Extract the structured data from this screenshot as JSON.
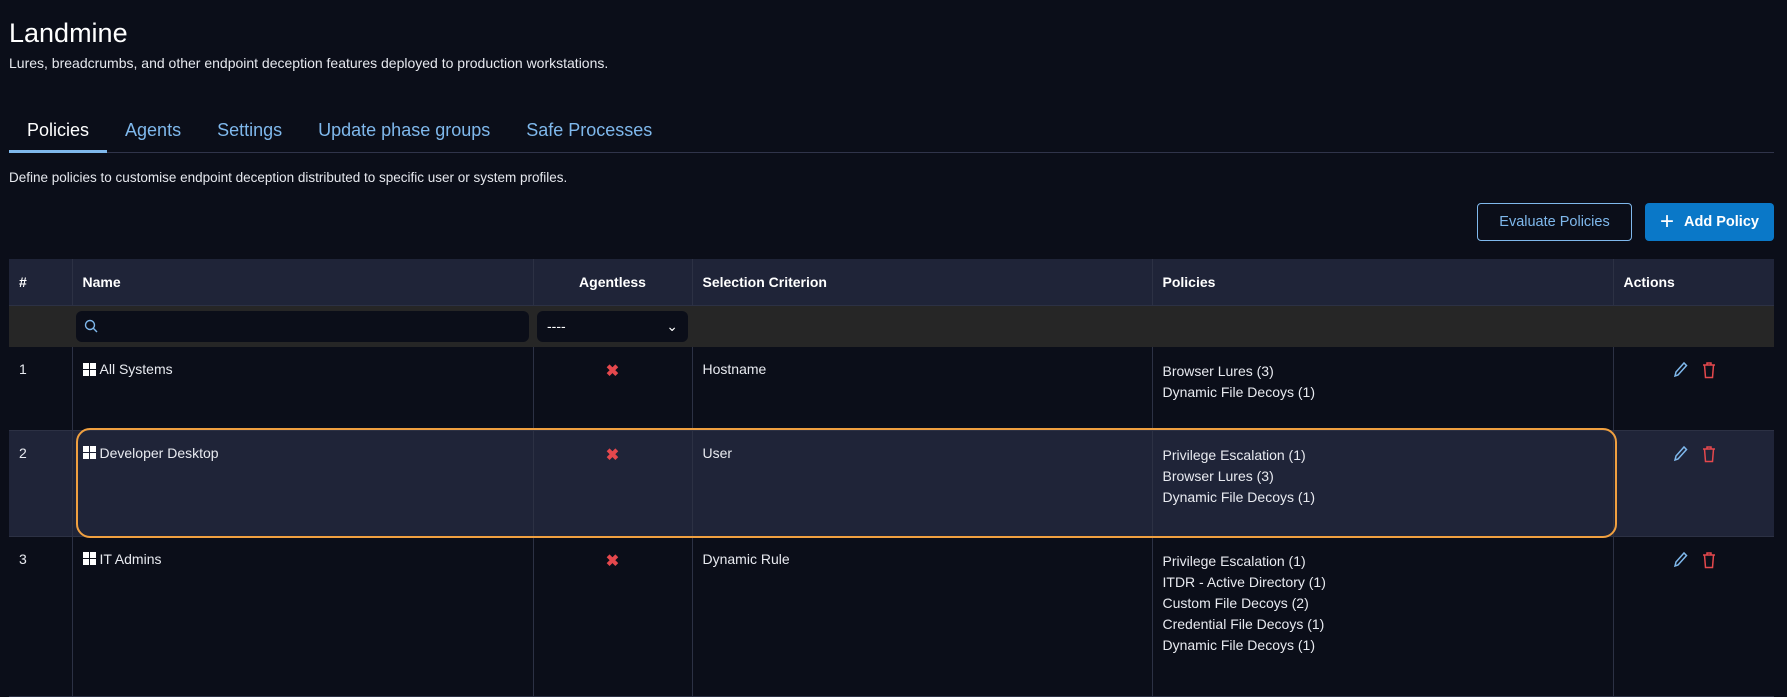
{
  "header": {
    "title": "Landmine",
    "subtitle": "Lures, breadcrumbs, and other endpoint deception features deployed to production workstations."
  },
  "tabs": [
    {
      "label": "Policies",
      "active": true
    },
    {
      "label": "Agents"
    },
    {
      "label": "Settings"
    },
    {
      "label": "Update phase groups"
    },
    {
      "label": "Safe Processes"
    }
  ],
  "description": "Define policies to customise endpoint deception distributed to specific user or system profiles.",
  "toolbar": {
    "evaluate_label": "Evaluate Policies",
    "add_label": "Add Policy"
  },
  "table": {
    "columns": [
      "#",
      "Name",
      "Agentless",
      "Selection Criterion",
      "Policies",
      "Actions"
    ],
    "filters": {
      "name_search_value": "",
      "agentless_selected": "----"
    },
    "rows": [
      {
        "num": "1",
        "name": "All Systems",
        "os": "windows",
        "agentless": "✖",
        "criterion": "Hostname",
        "policies": [
          "Browser Lures (3)",
          "Dynamic File Decoys (1)"
        ]
      },
      {
        "num": "2",
        "name": "Developer Desktop",
        "os": "windows",
        "agentless": "✖",
        "criterion": "User",
        "policies": [
          "Privilege Escalation (1)",
          "Browser Lures (3)",
          "Dynamic File Decoys (1)"
        ]
      },
      {
        "num": "3",
        "name": "IT Admins",
        "os": "windows",
        "agentless": "✖",
        "criterion": "Dynamic Rule",
        "policies": [
          "Privilege Escalation (1)",
          "ITDR - Active Directory (1)",
          "Custom File Decoys (2)",
          "Credential File Decoys (1)",
          "Dynamic File Decoys (1)"
        ]
      }
    ]
  },
  "colors": {
    "accent": "#7fb8ec",
    "primary_button": "#0a78c8",
    "danger": "#e5484d",
    "highlight": "#f0a040"
  }
}
